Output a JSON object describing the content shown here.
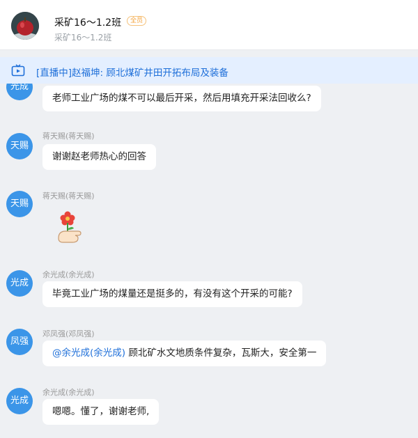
{
  "header": {
    "title": "采矿16～1.2班",
    "badge": "全员",
    "subtitle": "采矿16～1.2班"
  },
  "live": {
    "text": "[直播中]赵福坤: 顾北煤矿井田开拓布局及装备",
    "icon": "tv-icon"
  },
  "messages": [
    {
      "avatar": "光成",
      "sender": "",
      "text": "老师工业广场的煤不可以最后开采，然后用填充开采法回收么?"
    },
    {
      "avatar": "天赐",
      "sender": "蒋天赐(蒋天赐)",
      "text": "谢谢赵老师热心的回答"
    },
    {
      "avatar": "天赐",
      "sender": "蒋天赐(蒋天赐)",
      "sticker": "flower-hand-sticker"
    },
    {
      "avatar": "光成",
      "sender": "余光成(余光成)",
      "text": "毕竟工业广场的煤量还是挺多的，有没有这个开采的可能?"
    },
    {
      "avatar": "凤强",
      "sender": "邓凤强(邓凤强)",
      "mention": "@余光成(余光成)",
      "text": " 顾北矿水文地质条件复杂，瓦斯大，安全第一"
    },
    {
      "avatar": "光成",
      "sender": "余光成(余光成)",
      "text": "嗯嗯。懂了，谢谢老师,"
    }
  ],
  "colors": {
    "accent": "#1e6fd9",
    "avatar": "#3b95e8",
    "badge": "#f5a33b"
  }
}
